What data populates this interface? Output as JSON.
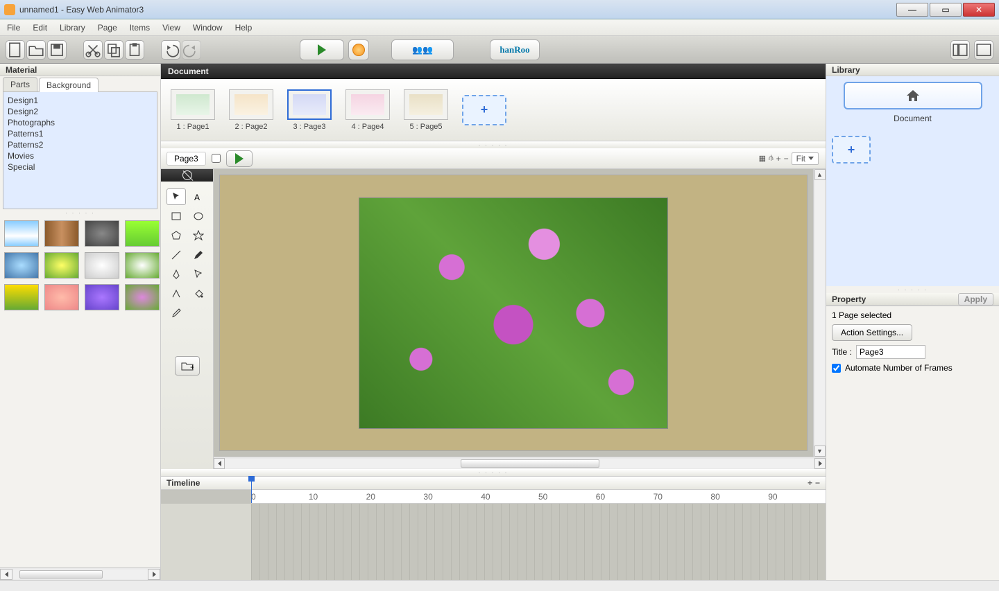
{
  "window": {
    "title": "unnamed1 - Easy Web Animator3"
  },
  "menu": [
    "File",
    "Edit",
    "Library",
    "Page",
    "Items",
    "View",
    "Window",
    "Help"
  ],
  "toolbar": {
    "brand": "hanRoo"
  },
  "left": {
    "panel": "Material",
    "tabs": {
      "parts": "Parts",
      "background": "Background"
    },
    "categories": [
      "Design1",
      "Design2",
      "Photographs",
      "Patterns1",
      "Patterns2",
      "Movies",
      "Special"
    ]
  },
  "center": {
    "docLabel": "Document",
    "pages": [
      "1 : Page1",
      "2 : Page2",
      "3 : Page3",
      "4 : Page4",
      "5 : Page5"
    ],
    "currentPage": "Page3",
    "zoom": "Fit",
    "timelineLabel": "Timeline",
    "rulerTicks": [
      "0",
      "10",
      "20",
      "30",
      "40",
      "50",
      "60",
      "70",
      "80",
      "90"
    ]
  },
  "right": {
    "libraryLabel": "Library",
    "documentLabel": "Document",
    "propertyLabel": "Property",
    "applyLabel": "Apply",
    "selectedText": "1 Page selected",
    "actionSettings": "Action Settings...",
    "titleLabel": "Title :",
    "titleValue": "Page3",
    "autoFramesLabel": "Automate Number of Frames"
  }
}
